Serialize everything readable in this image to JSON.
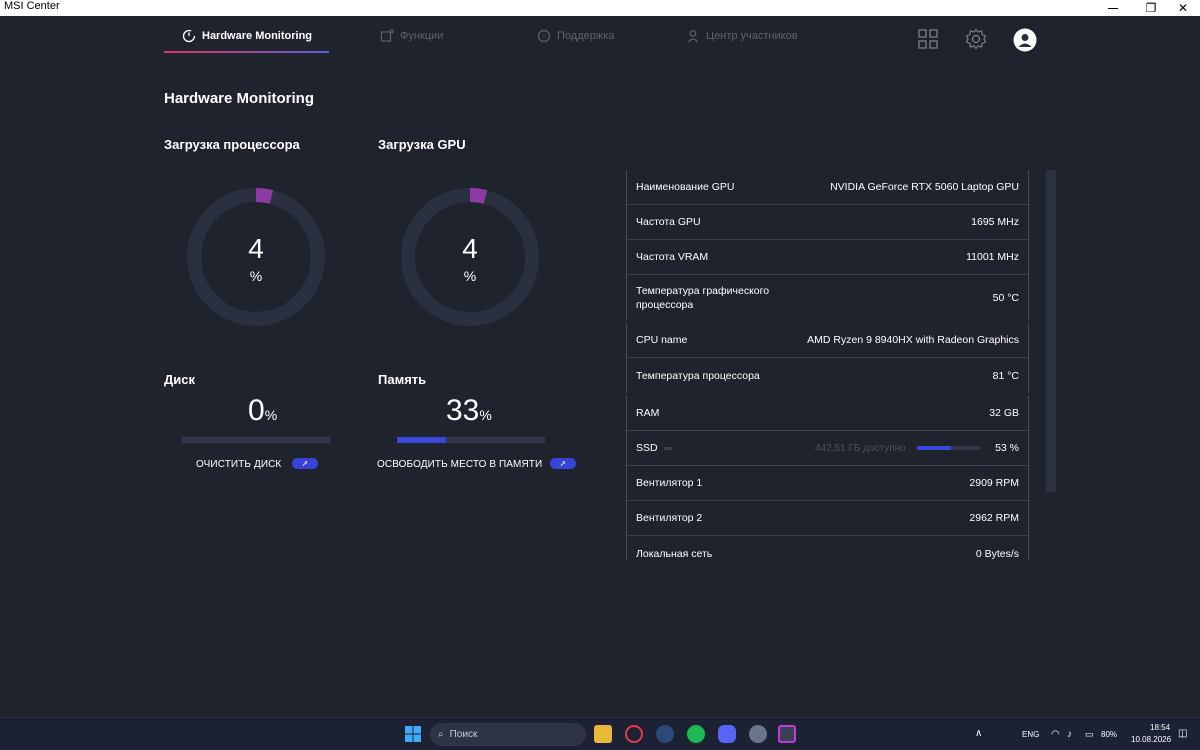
{
  "window": {
    "title": "MSI Center",
    "min": "—",
    "max": "❐",
    "close": "✕"
  },
  "tabs": [
    {
      "label": "Hardware Monitoring",
      "icon": "gauge-icon",
      "active": true
    },
    {
      "label": "Функции",
      "icon": "features-icon",
      "active": false
    },
    {
      "label": "Поддержка",
      "icon": "support-icon",
      "active": false
    },
    {
      "label": "Центр участников",
      "icon": "user-icon",
      "active": false
    }
  ],
  "header_icons": [
    "grid-icon",
    "settings-icon",
    "profile-icon"
  ],
  "page_title": "Hardware Monitoring",
  "cpu": {
    "label": "Загрузка процессора",
    "value": "4",
    "unit": "%",
    "percent": 4
  },
  "gpu": {
    "label": "Загрузка GPU",
    "value": "4",
    "unit": "%",
    "percent": 4
  },
  "disk": {
    "label": "Диск",
    "value": "0",
    "unit": "%",
    "percent": 0,
    "action": "ОЧИСТИТЬ ДИСК"
  },
  "memory": {
    "label": "Память",
    "value": "33",
    "unit": "%",
    "percent": 33,
    "action": "ОСВОБОДИТЬ МЕСТО В ПАМЯТИ"
  },
  "action_icon": "rocket-icon",
  "info": {
    "gpu_name": {
      "k": "Наименование GPU",
      "v": "NVIDIA GeForce RTX 5060 Laptop GPU"
    },
    "gpu_freq": {
      "k": "Частота GPU",
      "v": "1695 MHz"
    },
    "vram_freq": {
      "k": "Частота VRAM",
      "v": "11001 MHz"
    },
    "gpu_temp": {
      "k": "Температура графического процессора",
      "v": "50 °C"
    },
    "cpu_name": {
      "k": "CPU name",
      "v": "AMD Ryzen 9 8940HX with Radeon Graphics"
    },
    "cpu_temp": {
      "k": "Температура процессора",
      "v": "81 °C"
    },
    "ram": {
      "k": "RAM",
      "v": "32 GB"
    },
    "ssd": {
      "k": "SSD",
      "free": "442,51 ГБ доступно",
      "v": "53 %",
      "percent": 53
    },
    "fan1": {
      "k": "Вентилятор 1",
      "v": "2909 RPM"
    },
    "fan2": {
      "k": "Вентилятор 2",
      "v": "2962 RPM"
    },
    "lan": {
      "k": "Локальная сеть",
      "v": "0 Bytes/s"
    }
  },
  "taskbar": {
    "search_placeholder": "Поиск",
    "lang": "ENG",
    "battery": "80%",
    "time": "18:54",
    "date": "10.08.2026",
    "icons": [
      "start-icon",
      "explorer-icon",
      "opera-icon",
      "steam-icon",
      "spotify-icon",
      "discord-icon",
      "settings-icon",
      "msi-center-icon"
    ]
  },
  "colors": {
    "background": "#1f232e",
    "accent_blue": "#3b47dd",
    "gauge_track": "#2b3040",
    "gauge_arc": "#8e3aa4"
  }
}
